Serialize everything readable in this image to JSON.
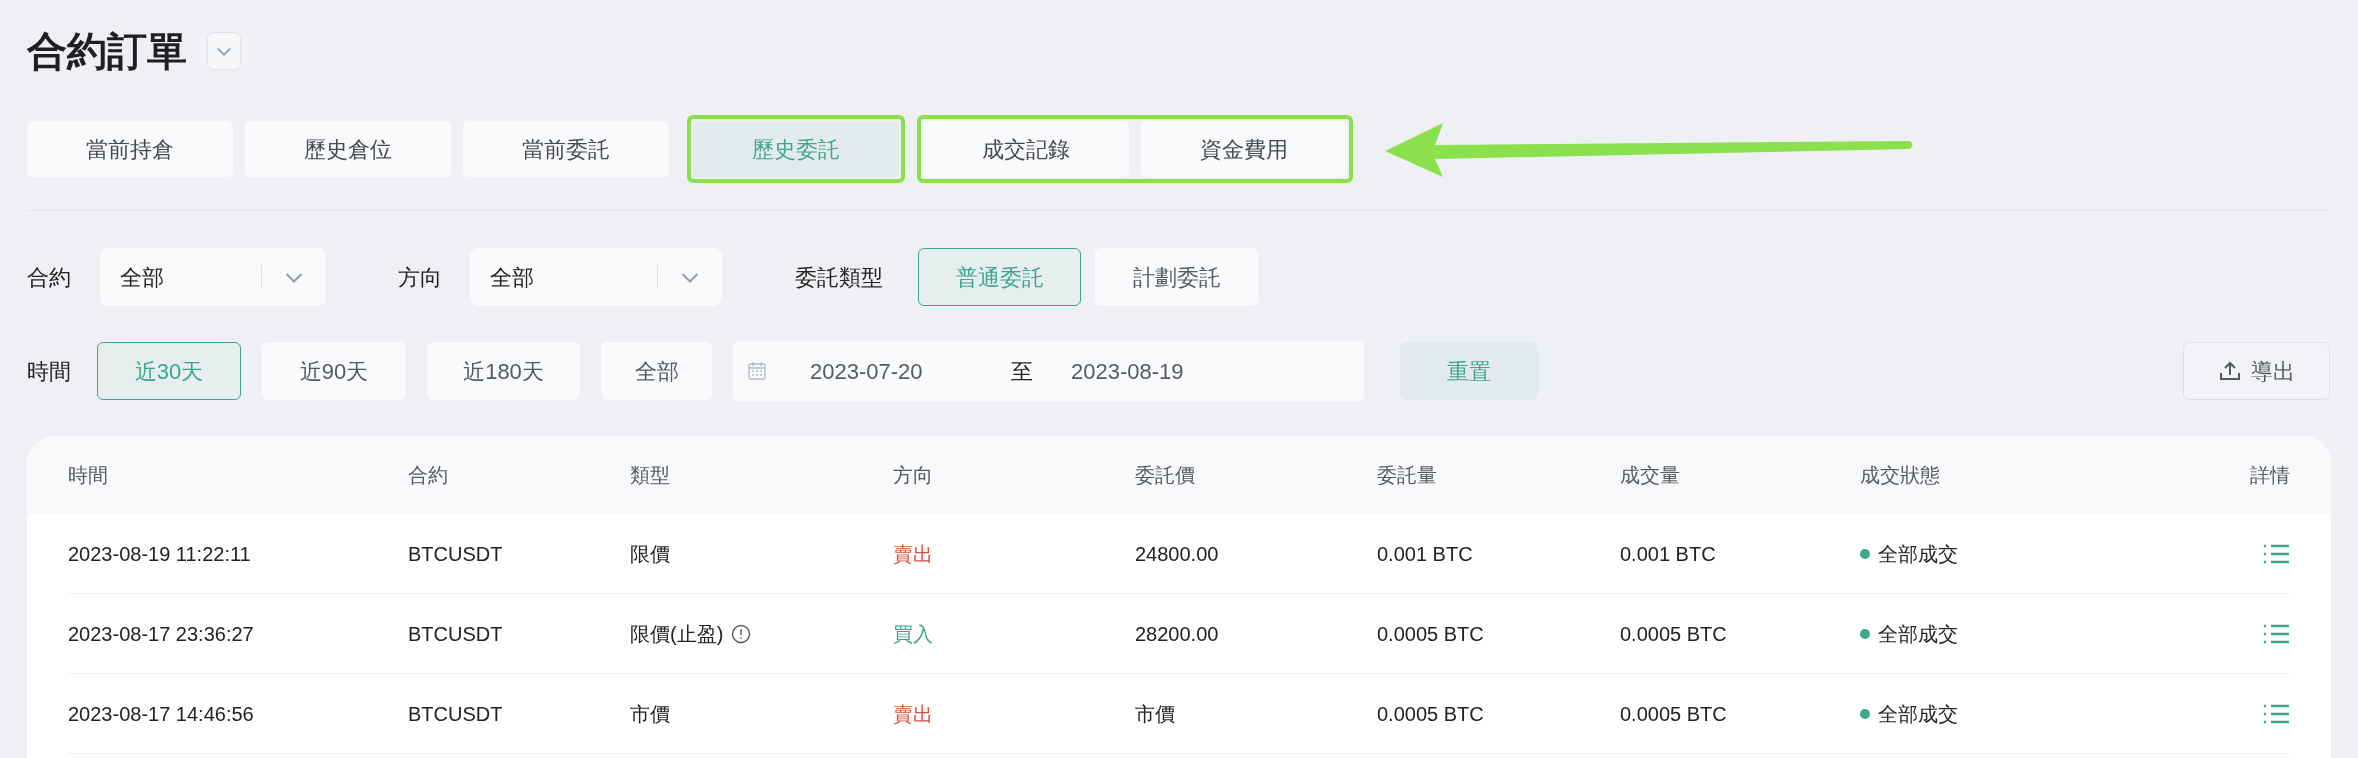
{
  "page_title": "合約訂單",
  "tab_groups": [
    {
      "outlined": false,
      "tabs": [
        {
          "label": "當前持倉",
          "selected": false
        },
        {
          "label": "歷史倉位",
          "selected": false
        },
        {
          "label": "當前委託",
          "selected": false
        }
      ]
    },
    {
      "outlined": true,
      "tabs": [
        {
          "label": "歷史委託",
          "selected": true
        }
      ]
    },
    {
      "outlined": true,
      "tabs": [
        {
          "label": "成交記錄",
          "selected": false
        },
        {
          "label": "資金費用",
          "selected": false
        }
      ]
    }
  ],
  "filters": {
    "contract": {
      "label": "合約",
      "value": "全部"
    },
    "direction": {
      "label": "方向",
      "value": "全部"
    },
    "order_type": {
      "label": "委託類型",
      "options": [
        {
          "label": "普通委託",
          "selected": true
        },
        {
          "label": "計劃委託",
          "selected": false
        }
      ]
    },
    "time": {
      "label": "時間",
      "ranges": [
        {
          "label": "近30天",
          "selected": true
        },
        {
          "label": "近90天",
          "selected": false
        },
        {
          "label": "近180天",
          "selected": false
        },
        {
          "label": "全部",
          "selected": false
        }
      ],
      "date_from": "2023-07-20",
      "separator": "至",
      "date_to": "2023-08-19"
    },
    "reset_button": "重置",
    "export_button": "導出"
  },
  "table": {
    "columns": [
      "時間",
      "合約",
      "類型",
      "方向",
      "委託價",
      "委託量",
      "成交量",
      "成交狀態",
      "詳情"
    ],
    "rows": [
      {
        "time": "2023-08-19 11:22:11",
        "contract": "BTCUSDT",
        "type": "限價",
        "type_info": false,
        "direction": {
          "text": "賣出",
          "kind": "sell"
        },
        "price": "24800.00",
        "amount": "0.001 BTC",
        "filled": "0.001 BTC",
        "status": {
          "text": "全部成交",
          "color": "#3ea68a"
        }
      },
      {
        "time": "2023-08-17 23:36:27",
        "contract": "BTCUSDT",
        "type": "限價(止盈)",
        "type_info": true,
        "direction": {
          "text": "買入",
          "kind": "buy"
        },
        "price": "28200.00",
        "amount": "0.0005 BTC",
        "filled": "0.0005 BTC",
        "status": {
          "text": "全部成交",
          "color": "#3ea68a"
        }
      },
      {
        "time": "2023-08-17 14:46:56",
        "contract": "BTCUSDT",
        "type": "市價",
        "type_info": false,
        "direction": {
          "text": "賣出",
          "kind": "sell"
        },
        "price": "市價",
        "amount": "0.0005 BTC",
        "filled": "0.0005 BTC",
        "status": {
          "text": "全部成交",
          "color": "#3ea68a"
        }
      }
    ]
  }
}
